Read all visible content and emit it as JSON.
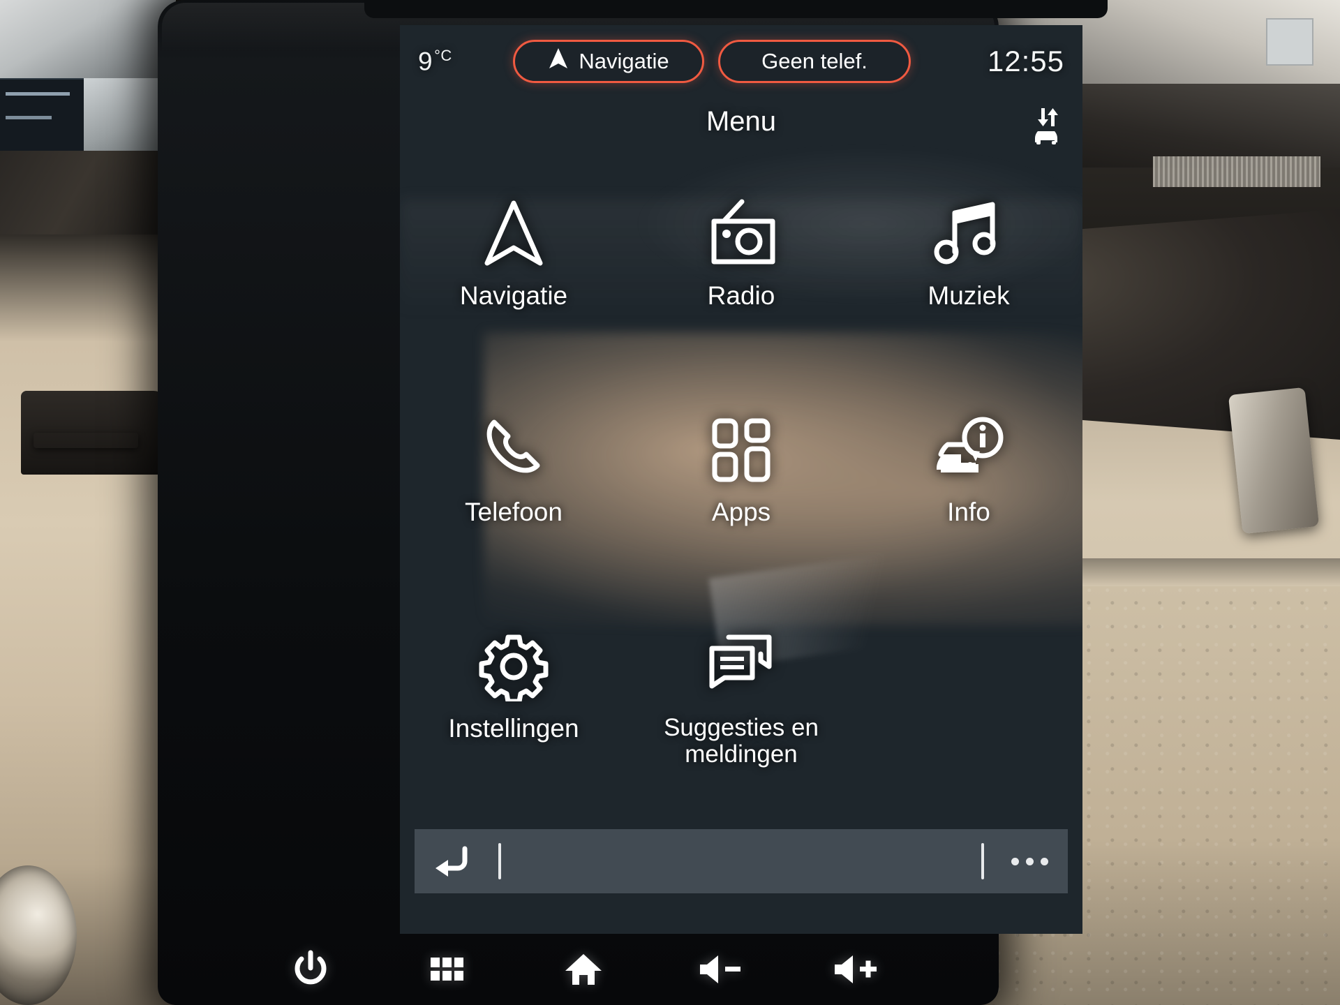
{
  "status_bar": {
    "temperature": "9",
    "temperature_unit": "°C",
    "nav_pill_label": "Navigatie",
    "nav_pill_icon": "navigation-arrow-icon",
    "phone_pill_label": "Geen telef.",
    "clock": "12:55",
    "accent_color": "#f05a41"
  },
  "header": {
    "title": "Menu",
    "climate_icon": "car-airflow-icon"
  },
  "menu": {
    "tiles": [
      {
        "label": "Navigatie",
        "icon": "navigation-arrow-icon"
      },
      {
        "label": "Radio",
        "icon": "radio-icon"
      },
      {
        "label": "Muziek",
        "icon": "music-note-icon"
      },
      {
        "label": "Telefoon",
        "icon": "phone-handset-icon"
      },
      {
        "label": "Apps",
        "icon": "apps-grid-icon"
      },
      {
        "label": "Info",
        "icon": "car-info-icon"
      },
      {
        "label": "Instellingen",
        "icon": "gear-icon"
      },
      {
        "label": "Suggesties en meldingen",
        "icon": "chat-bubbles-icon"
      }
    ]
  },
  "context_bar": {
    "back_icon": "back-arrow-icon",
    "more_icon": "more-dots-icon"
  },
  "hardware_keys": [
    {
      "icon": "power-icon"
    },
    {
      "icon": "apps-grid-small-icon"
    },
    {
      "icon": "home-icon"
    },
    {
      "icon": "volume-down-icon"
    },
    {
      "icon": "volume-up-icon"
    }
  ]
}
